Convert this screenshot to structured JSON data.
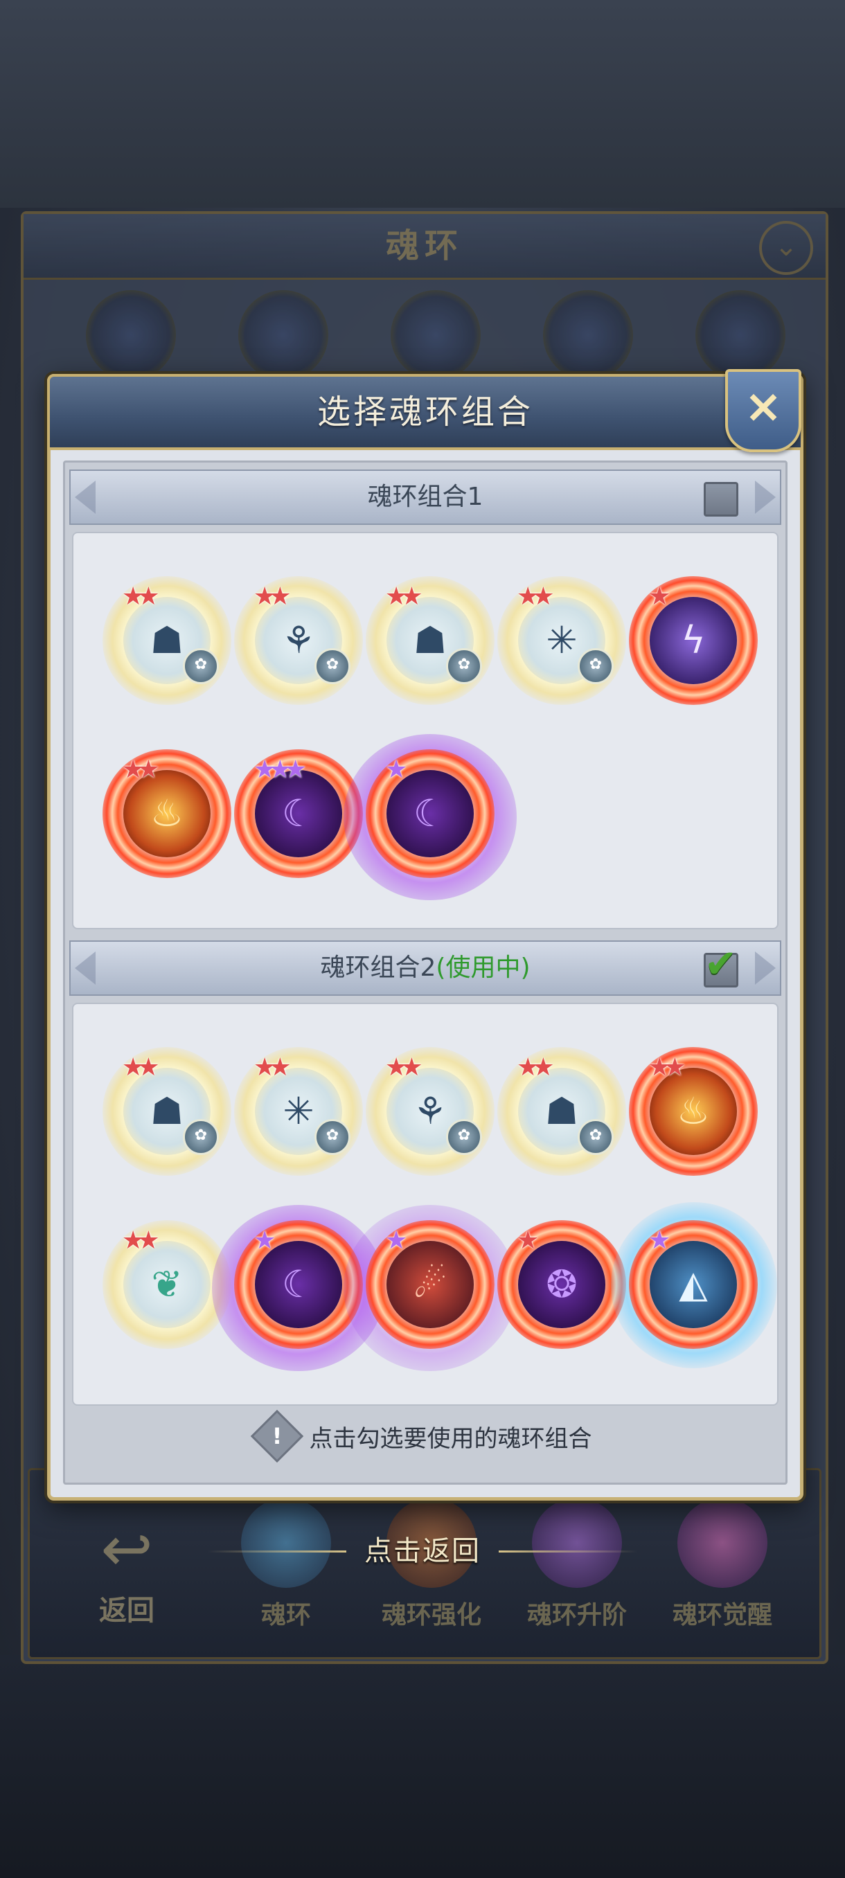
{
  "background": {
    "panel_title": "魂环",
    "bottom_bar": {
      "back_label": "返回",
      "items": [
        "魂环",
        "魂环强化",
        "魂环升阶",
        "魂环觉醒"
      ]
    }
  },
  "dialog": {
    "title": "选择魂环组合",
    "close_icon": "×",
    "groups": [
      {
        "title": "魂环组合1",
        "status": "",
        "checked": false,
        "rings": [
          {
            "type": "gold",
            "stars": 2,
            "glyph": "☗",
            "badge": true
          },
          {
            "type": "gold",
            "stars": 2,
            "glyph": "⚘",
            "badge": true
          },
          {
            "type": "gold",
            "stars": 2,
            "glyph": "☗",
            "badge": true
          },
          {
            "type": "gold",
            "stars": 2,
            "glyph": "✳",
            "badge": true
          },
          {
            "type": "red-electric",
            "stars": 1,
            "glyph": "ϟ",
            "badge": false
          },
          {
            "type": "red-flame",
            "stars": 2,
            "glyph": "♨",
            "badge": false
          },
          {
            "type": "red-dark",
            "stars": 3,
            "glyph": "☾",
            "badge": false
          },
          {
            "type": "red-dark-aura",
            "stars": 1,
            "glyph": "☾",
            "badge": false
          }
        ]
      },
      {
        "title": "魂环组合2",
        "status": "(使用中)",
        "checked": true,
        "rings": [
          {
            "type": "gold",
            "stars": 2,
            "glyph": "☗",
            "badge": true
          },
          {
            "type": "gold",
            "stars": 2,
            "glyph": "✳",
            "badge": true
          },
          {
            "type": "gold",
            "stars": 2,
            "glyph": "⚘",
            "badge": true
          },
          {
            "type": "gold",
            "stars": 2,
            "glyph": "☗",
            "badge": true
          },
          {
            "type": "red-flame",
            "stars": 2,
            "glyph": "♨",
            "badge": false
          },
          {
            "type": "gold-green",
            "stars": 2,
            "glyph": "❦",
            "badge": false
          },
          {
            "type": "red-dark-aura",
            "stars": 1,
            "glyph": "☾",
            "badge": false
          },
          {
            "type": "red-beast",
            "stars": 1,
            "glyph": "☄",
            "badge": false
          },
          {
            "type": "red-dark",
            "stars": 1,
            "glyph": "❂",
            "badge": false
          },
          {
            "type": "red-shark",
            "stars": 1,
            "glyph": "◭",
            "badge": false
          }
        ]
      }
    ],
    "hint": "点击勾选要使用的魂环组合",
    "hint_icon": "!"
  },
  "tap_back": "点击返回"
}
